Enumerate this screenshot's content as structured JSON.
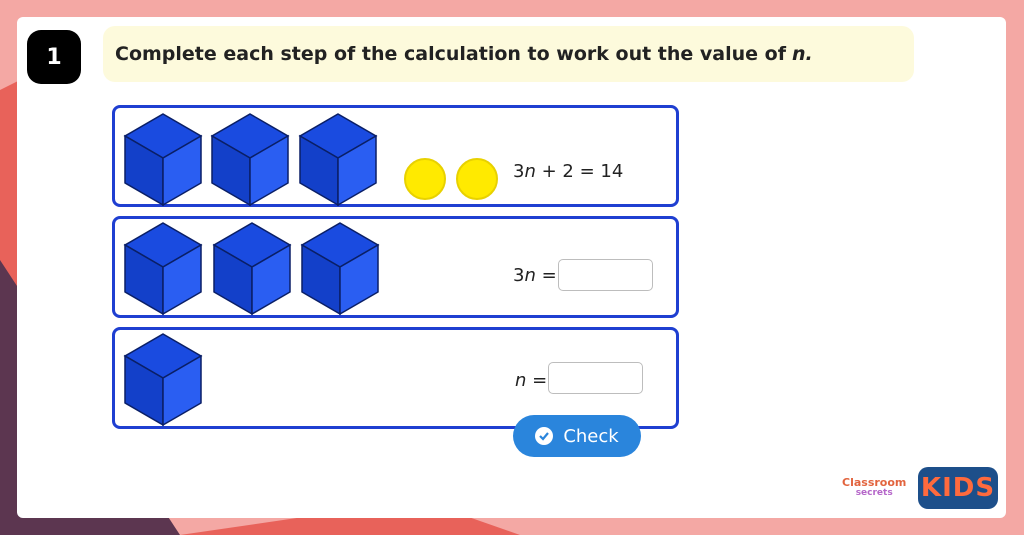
{
  "question": {
    "number": "1",
    "prompt_text": "Complete each step of the calculation to work out the value of",
    "prompt_var": "n."
  },
  "rows": [
    {
      "equation_var": "3n",
      "equation_rest": " + 2 = 14",
      "cubes": 3,
      "counters": 2
    },
    {
      "equation_lhs": "3n",
      "equation_eq": " =",
      "cubes": 3
    },
    {
      "equation_lhs": "n",
      "equation_eq": " =",
      "cubes": 1
    }
  ],
  "answer_inputs": {
    "value_1": "",
    "value_2": ""
  },
  "check_button": {
    "label": "Check"
  },
  "branding": {
    "classroom_secrets": "Classroom secrets",
    "cs_line1": "Classroom",
    "cs_line2": "secrets",
    "kids": "KIDS"
  },
  "colors": {
    "cube_blue": "#1a4be0",
    "row_border": "#1f3fd1",
    "counter_yellow": "#ffea00",
    "check_button_bg": "#2a85dc",
    "prompt_bg": "#fdfadc",
    "background_pink": "#f4a8a4"
  }
}
